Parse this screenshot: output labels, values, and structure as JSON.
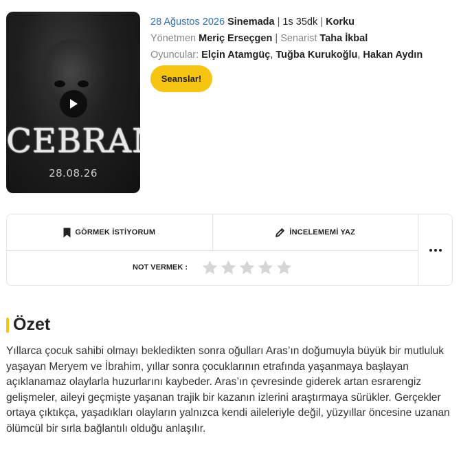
{
  "poster": {
    "title": "CEBRAN",
    "date": "28.08.26"
  },
  "info": {
    "release_date": "28 Ağustos 2026",
    "status": "Sinemada",
    "separator": "|",
    "duration": "1s 35dk",
    "genre": "Korku",
    "director_label": "Yönetmen",
    "director": "Meriç Erseçgen",
    "writer_label": "Senarist",
    "writer": "Taha İkbal",
    "cast_label": "Oyuncular:",
    "cast": [
      "Elçin Atamgüç",
      "Tuğba Kurukoğlu",
      "Hakan Aydın"
    ],
    "comma": ","
  },
  "seans_button": "Seanslar!",
  "actions": {
    "watchlist": "GÖRMEK İSTİYORUM",
    "review": "İNCELEMEMİ YAZ",
    "rate_label": "NOT VERMEK :",
    "rating": 0,
    "max_rating": 5
  },
  "summary": {
    "title": "Özet",
    "text": "Yıllarca çocuk sahibi olmayı bekledikten sonra oğulları Aras’ın doğumuyla büyük bir mutluluk yaşayan Meryem ve İbrahim, yıllar sonra çocuklarının etrafında yaşanmaya başlayan açıklanamaz olaylarla huzurlarını kaybeder. Aras’ın çevresinde giderek artan esrarengiz gelişmeler, aileyi geçmişte yaşanan trajik bir kazanın izlerini araştırmaya sürükler. Gerçekler ortaya çıktıkça, yaşadıkları olayların yalnızca kendi aileleriyle değil, yüzyıllar öncesine uzanan ölümcül bir sırla bağlantılı olduğu anlaşılır."
  },
  "colors": {
    "accent": "#f6c412",
    "link_blue": "#2f6fb5",
    "star_empty": "#d6d6d6"
  }
}
